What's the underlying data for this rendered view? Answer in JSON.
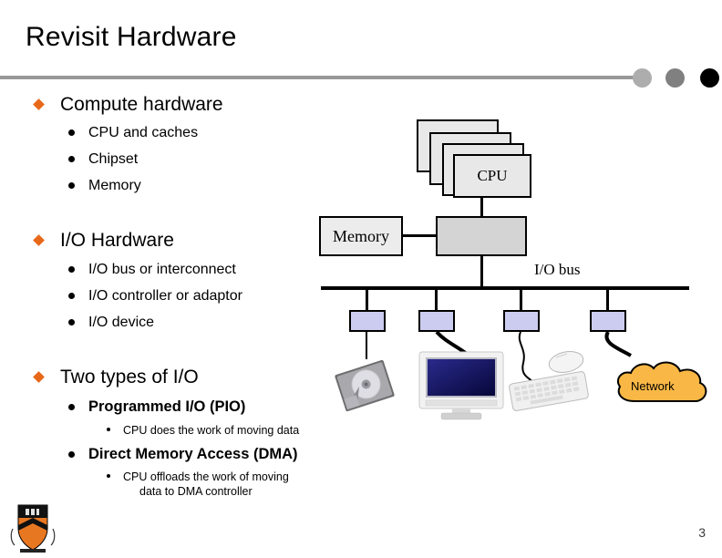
{
  "slide": {
    "title": "Revisit Hardware",
    "page_number": "3",
    "logo_name": "princeton-shield-logo"
  },
  "decor": {
    "dot_colors": [
      "#adadad",
      "#808080",
      "#000000"
    ],
    "rule_color": "#999999"
  },
  "outline": [
    {
      "label": "Compute hardware",
      "children": [
        {
          "label": "CPU and caches"
        },
        {
          "label": "Chipset"
        },
        {
          "label": "Memory"
        }
      ]
    },
    {
      "label": "I/O Hardware",
      "children": [
        {
          "label": "I/O bus or interconnect"
        },
        {
          "label": "I/O controller or adaptor"
        },
        {
          "label": "I/O device"
        }
      ]
    },
    {
      "label": "Two types of I/O",
      "children": [
        {
          "label": "Programmed I/O (PIO)",
          "bold": true,
          "children": [
            {
              "label": "CPU does the work of moving data"
            }
          ]
        },
        {
          "label": "Direct Memory Access (DMA)",
          "bold": true,
          "children": [
            {
              "label": "CPU offloads the work of moving"
            },
            {
              "label": "data to DMA controller"
            }
          ]
        }
      ]
    }
  ],
  "diagram": {
    "cpu_label": "CPU",
    "cpu_stack_count": 4,
    "memory_label": "Memory",
    "chipset_label": "",
    "io_bus_label": "I/O bus",
    "network_label": "Network",
    "adaptor_count": 4,
    "devices": [
      {
        "name": "hard-disk-device"
      },
      {
        "name": "monitor-device"
      },
      {
        "name": "keyboard-mouse-device"
      },
      {
        "name": "network-cloud-device"
      }
    ],
    "colors": {
      "cpu_fill": "#e8e8e8",
      "memory_fill": "#ececec",
      "chipset_fill": "#d4d4d4",
      "adaptor_fill": "#ccccf0",
      "cloud_fill": "#F9B845",
      "monitor_screen": "#121266",
      "bullet_accent": "#E8681A"
    }
  }
}
